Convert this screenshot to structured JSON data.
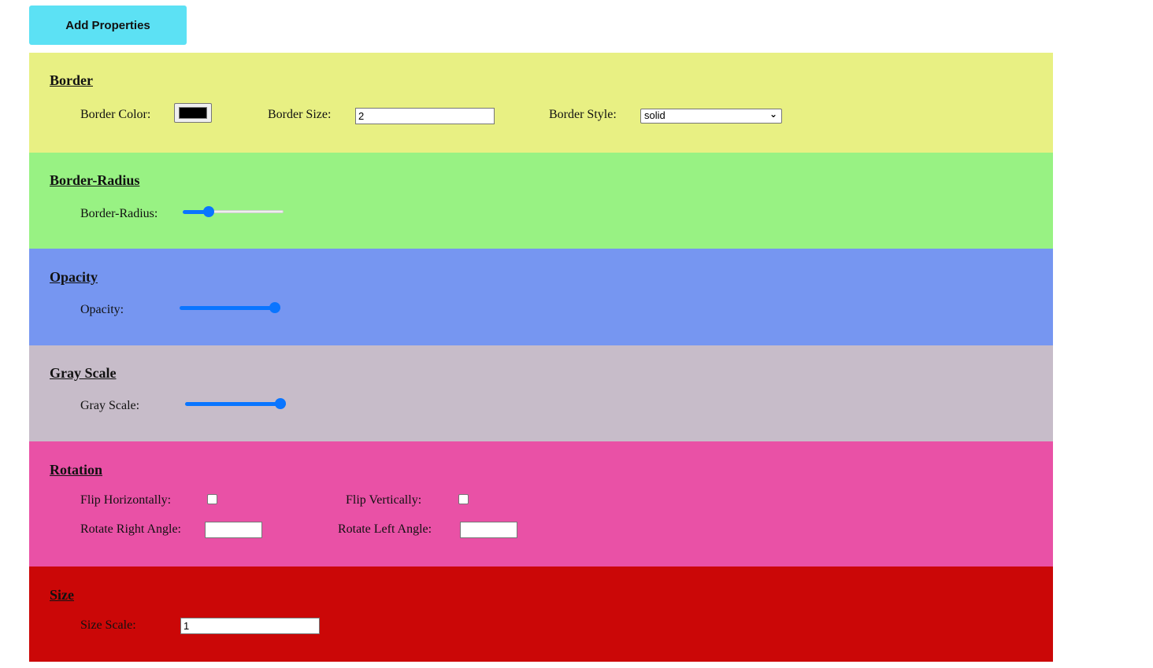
{
  "toolbar": {
    "add_label": "Add Properties"
  },
  "border": {
    "heading": "Border",
    "color_label": "Border Color:",
    "color_value": "#000000",
    "size_label": "Border Size:",
    "size_value": "2",
    "style_label": "Border Style:",
    "style_value": "solid"
  },
  "radius": {
    "heading": "Border-Radius",
    "label": "Border-Radius:",
    "value_fraction": 0.25
  },
  "opacity": {
    "heading": "Opacity",
    "label": "Opacity:",
    "value_fraction": 1.0
  },
  "gray": {
    "heading": "Gray Scale",
    "label": "Gray Scale:",
    "value_fraction": 1.0
  },
  "rotation": {
    "heading": "Rotation",
    "flip_h_label": "Flip Horizontally:",
    "flip_v_label": "Flip Vertically:",
    "rotate_right_label": "Rotate Right Angle:",
    "rotate_left_label": "Rotate Left Angle:",
    "rotate_right_value": "",
    "rotate_left_value": ""
  },
  "size": {
    "heading": "Size",
    "label": "Size Scale:",
    "value": "1"
  },
  "colors": {
    "button": "#5ce1f4",
    "border_panel": "#e8f083",
    "radius_panel": "#98f283",
    "opacity_panel": "#7696f1",
    "gray_panel": "#c7bcc9",
    "rotation_panel": "#e951a6",
    "size_panel": "#cb0707",
    "slider_accent": "#0a75ff"
  }
}
